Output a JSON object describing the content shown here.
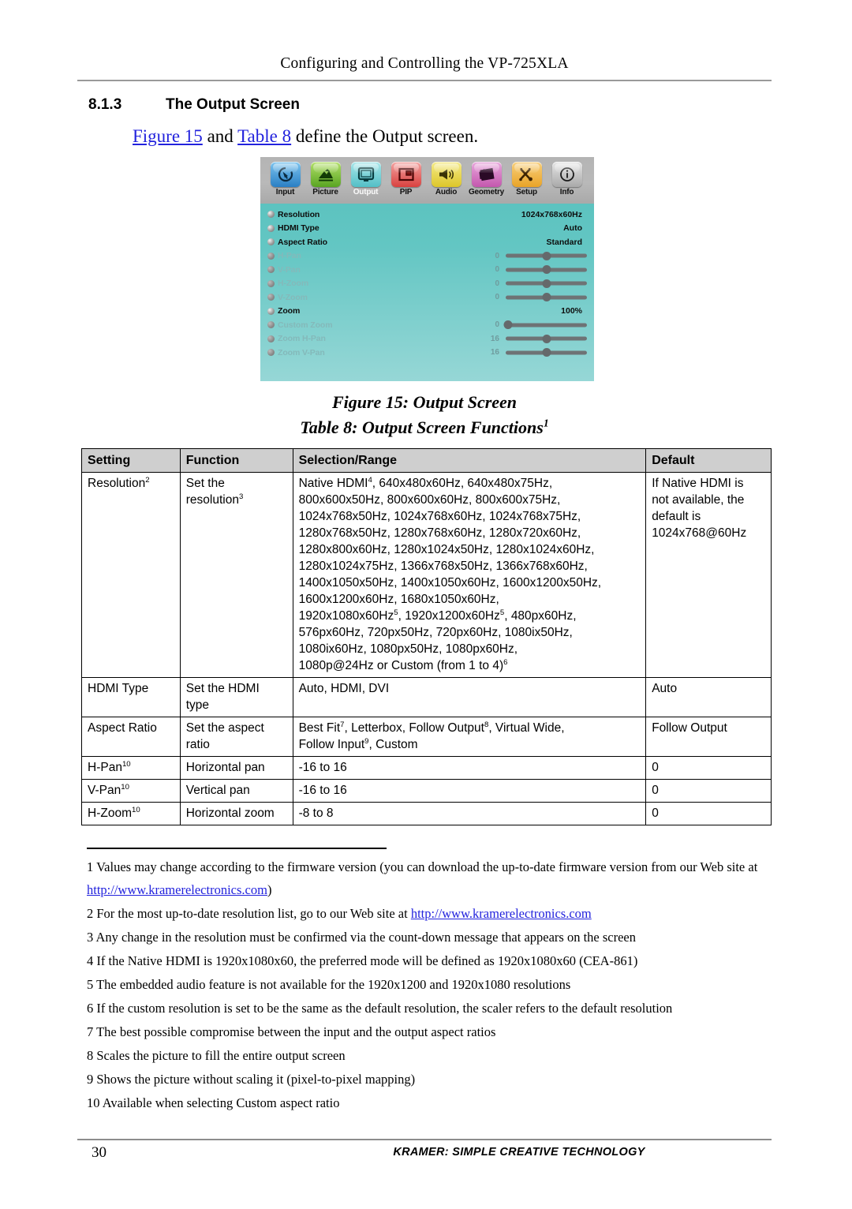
{
  "header": {
    "title": "Configuring and Controlling the VP-725XLA"
  },
  "section": {
    "number": "8.1.3",
    "title": "The Output Screen",
    "intro_figure_link": "Figure 15",
    "intro_mid": " and ",
    "intro_table_link": "Table 8",
    "intro_tail": " define the Output screen."
  },
  "osd": {
    "tabs": [
      {
        "label": "Input",
        "icon": "cursor-arrow-icon",
        "color": "#2a7fc4",
        "active": false
      },
      {
        "label": "Picture",
        "icon": "mountain-icon",
        "color": "#59a521",
        "active": false
      },
      {
        "label": "Output",
        "icon": "monitor-icon",
        "color": "#53bfc6",
        "active": true
      },
      {
        "label": "PIP",
        "icon": "picture-in-picture-icon",
        "color": "#d9413f",
        "active": false
      },
      {
        "label": "Audio",
        "icon": "speaker-icon",
        "color": "#ddc62a",
        "active": false
      },
      {
        "label": "Geometry",
        "icon": "keystone-icon",
        "color": "#c457ae",
        "active": false
      },
      {
        "label": "Setup",
        "icon": "tools-icon",
        "color": "#e9a428",
        "active": false
      },
      {
        "label": "Info",
        "icon": "info-circle-icon",
        "color": "#a9a9a9",
        "active": false
      }
    ],
    "rows": [
      {
        "label": "Resolution",
        "value": "1024x768x60Hz",
        "enabled": true,
        "slider": false
      },
      {
        "label": "HDMI Type",
        "value": "Auto",
        "enabled": true,
        "slider": false
      },
      {
        "label": "Aspect Ratio",
        "value": "Standard",
        "enabled": true,
        "slider": false
      },
      {
        "label": "H-Pan",
        "number": "0",
        "enabled": false,
        "slider": true,
        "thumb_pct": 50
      },
      {
        "label": "V-Pan",
        "number": "0",
        "enabled": false,
        "slider": true,
        "thumb_pct": 50
      },
      {
        "label": "H-Zoom",
        "number": "0",
        "enabled": false,
        "slider": true,
        "thumb_pct": 50
      },
      {
        "label": "V-Zoom",
        "number": "0",
        "enabled": false,
        "slider": true,
        "thumb_pct": 50
      },
      {
        "label": "Zoom",
        "value": "100%",
        "enabled": true,
        "slider": false
      },
      {
        "label": "Custom Zoom",
        "number": "0",
        "enabled": false,
        "slider": true,
        "thumb_pct": 3
      },
      {
        "label": "Zoom H-Pan",
        "number": "16",
        "enabled": false,
        "slider": true,
        "thumb_pct": 50
      },
      {
        "label": "Zoom V-Pan",
        "number": "16",
        "enabled": false,
        "slider": true,
        "thumb_pct": 50
      }
    ]
  },
  "captions": {
    "figure": "Figure 15: Output Screen",
    "table_prefix": "Table 8: Output Screen Functions",
    "table_sup": "1"
  },
  "table": {
    "headers": [
      "Setting",
      "Function",
      "Selection/Range",
      "Default"
    ],
    "rows": [
      {
        "setting": "Resolution",
        "setting_sup": "2",
        "function_lines": [
          "Set the",
          "resolution"
        ],
        "function_sup": "3",
        "range_lines": [
          "Native HDMI|4|, 640x480x60Hz, 640x480x75Hz,",
          "800x600x50Hz, 800x600x60Hz, 800x600x75Hz,",
          "1024x768x50Hz, 1024x768x60Hz, 1024x768x75Hz,",
          "1280x768x50Hz, 1280x768x60Hz, 1280x720x60Hz,",
          "1280x800x60Hz, 1280x1024x50Hz, 1280x1024x60Hz,",
          "1280x1024x75Hz, 1366x768x50Hz, 1366x768x60Hz,",
          "1400x1050x50Hz, 1400x1050x60Hz, 1600x1200x50Hz,",
          "1600x1200x60Hz, 1680x1050x60Hz,",
          "1920x1080x60Hz|5|, 1920x1200x60Hz|5|, 480px60Hz,",
          "576px60Hz, 720px50Hz, 720px60Hz, 1080ix50Hz,",
          "1080ix60Hz, 1080px50Hz, 1080px60Hz,",
          "1080p@24Hz or Custom (from 1 to 4)|6|"
        ],
        "default_lines": [
          "If Native HDMI is",
          "not available, the",
          "default is",
          "1024x768@60Hz"
        ]
      },
      {
        "setting": "HDMI Type",
        "setting_sup": "",
        "function_lines": [
          "Set the HDMI",
          "type"
        ],
        "function_sup": "",
        "range_lines": [
          "Auto, HDMI, DVI"
        ],
        "default_lines": [
          "Auto"
        ]
      },
      {
        "setting": "Aspect Ratio",
        "setting_sup": "",
        "function_lines": [
          "Set the aspect",
          "ratio"
        ],
        "function_sup": "",
        "range_lines": [
          "Best Fit|7|, Letterbox, Follow Output|8|, Virtual Wide,",
          "Follow Input|9|, Custom"
        ],
        "default_lines": [
          "Follow Output"
        ]
      },
      {
        "setting": "H-Pan",
        "setting_sup": "10",
        "function_lines": [
          "Horizontal pan"
        ],
        "function_sup": "",
        "range_lines": [
          "-16 to 16"
        ],
        "default_lines": [
          "0"
        ]
      },
      {
        "setting": "V-Pan",
        "setting_sup": "10",
        "function_lines": [
          "Vertical pan"
        ],
        "function_sup": "",
        "range_lines": [
          "-16 to 16"
        ],
        "default_lines": [
          "0"
        ]
      },
      {
        "setting": "H-Zoom",
        "setting_sup": "10",
        "function_lines": [
          "Horizontal zoom"
        ],
        "function_sup": "",
        "range_lines": [
          "-8 to 8"
        ],
        "default_lines": [
          "0"
        ]
      }
    ]
  },
  "footnotes": [
    {
      "num": "1",
      "text_a": "Values may change according to the firmware version (you can download the up-to-date firmware version from our Web site at ",
      "link": "http://www.kramerelectronics.com",
      "text_b": ")"
    },
    {
      "num": "2",
      "text_a": "For the most up-to-date resolution list, go to our Web site at ",
      "link": "http://www.kramerelectronics.com",
      "text_b": ""
    },
    {
      "num": "3",
      "text_a": "Any change in the resolution must be confirmed via the count-down message that appears on the screen",
      "link": "",
      "text_b": ""
    },
    {
      "num": "4",
      "text_a": "If the Native HDMI is 1920x1080x60, the preferred mode will be defined as 1920x1080x60 (CEA-861)",
      "link": "",
      "text_b": ""
    },
    {
      "num": "5",
      "text_a": "The embedded audio feature is not available for the 1920x1200 and 1920x1080 resolutions",
      "link": "",
      "text_b": ""
    },
    {
      "num": "6",
      "text_a": "If the custom resolution is set to be the same as the default resolution, the scaler refers to the default resolution",
      "link": "",
      "text_b": ""
    },
    {
      "num": "7",
      "text_a": "The best possible compromise between the input and the output aspect ratios",
      "link": "",
      "text_b": ""
    },
    {
      "num": "8",
      "text_a": "Scales the picture to fill the entire output screen",
      "link": "",
      "text_b": ""
    },
    {
      "num": "9",
      "text_a": "Shows the picture without scaling it (pixel-to-pixel mapping)",
      "link": "",
      "text_b": ""
    },
    {
      "num": "10",
      "text_a": "Available when selecting Custom aspect ratio",
      "link": "",
      "text_b": ""
    }
  ],
  "footer": {
    "page_number": "30",
    "brand": "KRAMER: SIMPLE CREATIVE TECHNOLOGY"
  }
}
